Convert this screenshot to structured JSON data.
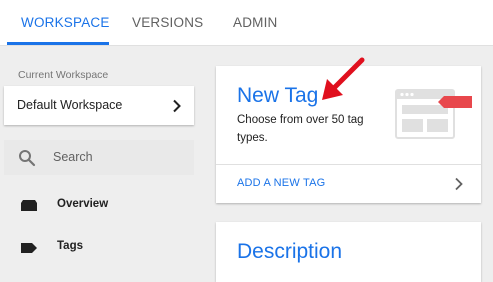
{
  "tabs": [
    {
      "label": "WORKSPACE",
      "active": true
    },
    {
      "label": "VERSIONS",
      "active": false
    },
    {
      "label": "ADMIN",
      "active": false
    }
  ],
  "sidebar": {
    "current_workspace_label": "Current Workspace",
    "workspace_name": "Default Workspace",
    "search_placeholder": "Search",
    "nav": [
      {
        "label": "Overview",
        "icon": "folder-icon"
      },
      {
        "label": "Tags",
        "icon": "tag-icon"
      }
    ]
  },
  "new_tag_card": {
    "title": "New Tag",
    "description": "Choose from over 50 tag types.",
    "action_label": "ADD A NEW TAG"
  },
  "description_card": {
    "title": "Description"
  },
  "colors": {
    "accent": "#1a73e8",
    "annotation_arrow": "#e0101e",
    "illustration_red": "#e8474c"
  }
}
